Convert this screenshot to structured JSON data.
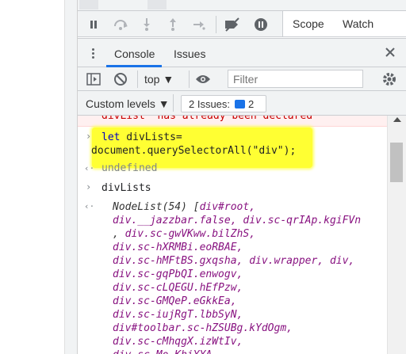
{
  "debugger_toolbar": {
    "icons": [
      "pause-icon",
      "step-over-icon",
      "step-into-icon",
      "step-out-icon",
      "step-icon",
      "deactivate-breakpoints-icon",
      "pause-on-exceptions-icon"
    ],
    "tabs": [
      {
        "label": "Scope"
      },
      {
        "label": "Watch"
      }
    ]
  },
  "drawer": {
    "tabs": [
      {
        "label": "Console",
        "active": true
      },
      {
        "label": "Issues",
        "active": false
      }
    ]
  },
  "console_toolbar": {
    "context": "top",
    "filter_placeholder": "Filter"
  },
  "levels_bar": {
    "levels_label": "Custom levels",
    "issues_button_label": "2 Issues:",
    "issues_count": "2"
  },
  "console": {
    "error_text": "divList  has already been declared",
    "command1": {
      "line1_kw": "let",
      "line1_rest": " divLists=",
      "line2": "document.querySelectorAll(\"div\");"
    },
    "result1": "undefined",
    "command2": "divLists",
    "nodelist_head": "NodeList(54) [",
    "nodelist_lines": [
      {
        "prefix": "",
        "items": [
          "div#root,"
        ]
      },
      {
        "prefix": "",
        "items": [
          "div.__jazzbar.false,",
          "div.sc-qrIAp.kgiFVn"
        ]
      },
      {
        "prefix": ", ",
        "items": [
          "div.sc-gwVKww.bilZhS,"
        ]
      },
      {
        "prefix": "",
        "items": [
          "div.sc-hXRMBi.eoRBAE,"
        ]
      },
      {
        "prefix": "",
        "items": [
          "div.sc-hMFtBS.gxqsha,",
          "div.wrapper,",
          "div,"
        ]
      },
      {
        "prefix": "",
        "items": [
          "div.sc-gqPbQI.enwogv,"
        ]
      },
      {
        "prefix": "",
        "items": [
          "div.sc-cLQEGU.hEfPzw,"
        ]
      },
      {
        "prefix": "",
        "items": [
          "div.sc-GMQeP.eGkkEa,"
        ]
      },
      {
        "prefix": "",
        "items": [
          "div.sc-iujRgT.lbbSyN,"
        ]
      },
      {
        "prefix": "",
        "items": [
          "div#toolbar.sc-hZSUBg.kYdOgm,"
        ]
      },
      {
        "prefix": "",
        "items": [
          "div.sc-cMhqgX.izWtIv,"
        ]
      },
      {
        "prefix": "",
        "items": [
          "div.sc-Mo.KhiYYA,"
        ]
      }
    ]
  },
  "colors": {
    "highlight": "#ffff33",
    "accent": "#1a73e8",
    "error": "#c80000"
  }
}
